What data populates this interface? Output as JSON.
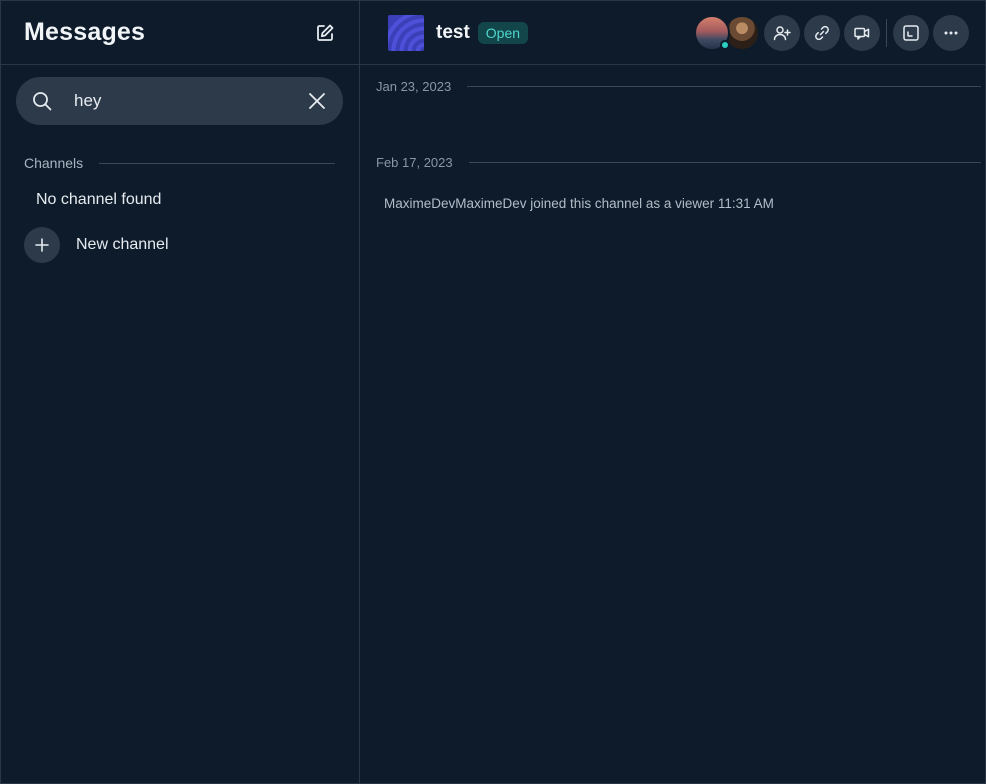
{
  "sidebar": {
    "title": "Messages",
    "search": {
      "value": "hey",
      "placeholder": "Search"
    },
    "section_label": "Channels",
    "empty_text": "No channel found",
    "new_channel_label": "New channel"
  },
  "header": {
    "channel_name": "test",
    "status": "Open"
  },
  "timeline": {
    "dates": [
      "Jan 23, 2023",
      "Feb 17, 2023"
    ],
    "system_message": "MaximeDevMaximeDev joined this channel as a viewer 11:31 AM"
  },
  "colors": {
    "background": "#0d1b2a",
    "surface": "#2c3a4a",
    "accent_teal": "#2ad1c2",
    "badge_bg": "#12464a",
    "badge_text": "#4fd6cc"
  },
  "icons": [
    "compose-icon",
    "search-icon",
    "close-icon",
    "plus-icon",
    "add-user-icon",
    "link-icon",
    "video-call-icon",
    "expand-icon",
    "more-icon"
  ]
}
